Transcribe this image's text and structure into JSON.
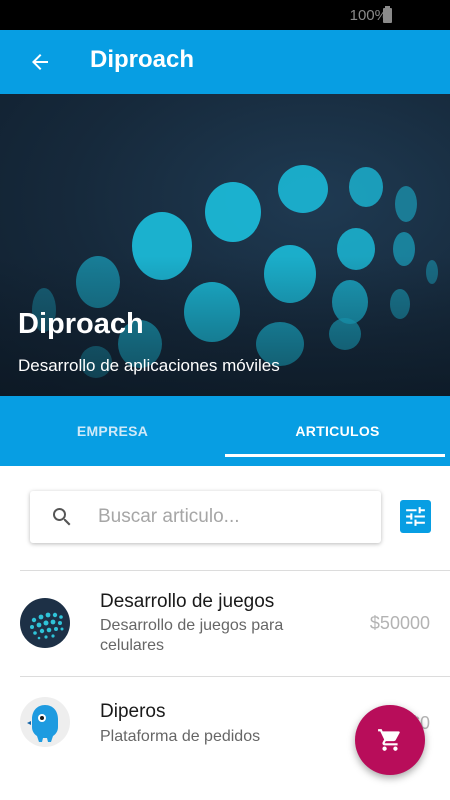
{
  "status_bar": {
    "battery_text": "100%",
    "battery_icon": "battery-full-icon"
  },
  "app_bar": {
    "back_icon": "arrow-back-icon",
    "title": "Diproach"
  },
  "hero": {
    "title": "Diproach",
    "subtitle": "Desarrollo de aplicaciones móviles"
  },
  "tabs": [
    {
      "label": "EMPRESA",
      "active": false
    },
    {
      "label": "ARTICULOS",
      "active": true
    }
  ],
  "search": {
    "icon": "search-icon",
    "placeholder": "Buscar articulo...",
    "value": ""
  },
  "filter": {
    "icon": "tune-sliders-icon"
  },
  "items": [
    {
      "title": "Desarrollo de juegos",
      "description": "Desarrollo de juegos para celulares",
      "price": "$50000",
      "avatar": "dotted-sphere-logo"
    },
    {
      "title": "Diperos",
      "description": "Plataforma de pedidos",
      "price": "$0",
      "avatar": "blue-bird-mascot"
    }
  ],
  "fab": {
    "icon": "shopping-cart-icon"
  },
  "colors": {
    "primary": "#079ee3",
    "accent": "#b80d5a",
    "hero_dark": "#16293b"
  }
}
